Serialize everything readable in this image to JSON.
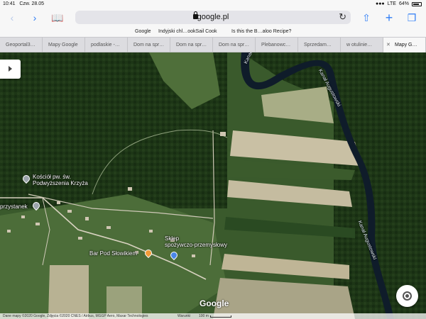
{
  "status": {
    "time": "10:41",
    "date": "Czw. 28.05",
    "carrier": "LTE",
    "battery": "64%"
  },
  "toolbar": {
    "url": "google.pl"
  },
  "bookmarks": [
    "Google",
    "Indyjski chl…ookSail Cook",
    "Is this the B…aloo Recipe?"
  ],
  "tabs": [
    {
      "label": "Geoportal3…"
    },
    {
      "label": "Mapy Google"
    },
    {
      "label": "podlaskie -…"
    },
    {
      "label": "Dom na spr…"
    },
    {
      "label": "Dom na spr…"
    },
    {
      "label": "Dom na spr…"
    },
    {
      "label": "Plebanowc…"
    },
    {
      "label": "Sprzedam…"
    },
    {
      "label": "w otulinie…"
    },
    {
      "label": "Mapy G…",
      "active": true
    }
  ],
  "map": {
    "labels": {
      "church": "Kościół pw. św.\nPodwyższenia Krzyża",
      "stop": "przystanek",
      "shop": "Sklep\nspożywczo-przemysłowy",
      "bar": "Bar Pod Słowikiem",
      "canal_upper_left": "Kanał Augustowski",
      "canal_upper_right": "Kanał Augustowski",
      "canal_lower": "Kanał Augustowski"
    },
    "logo": "Google",
    "footer": {
      "attribution": "Dane mapy ©2020 Google, Zdjęcia ©2020 CNES / Airbus, MGGP Aero, Maxar Technologies",
      "terms": "Warunki",
      "scale": "100 m"
    }
  },
  "colors": {
    "accent": "#2f7df6",
    "forest": "#1e3a18",
    "field": "#c9c0a4"
  }
}
